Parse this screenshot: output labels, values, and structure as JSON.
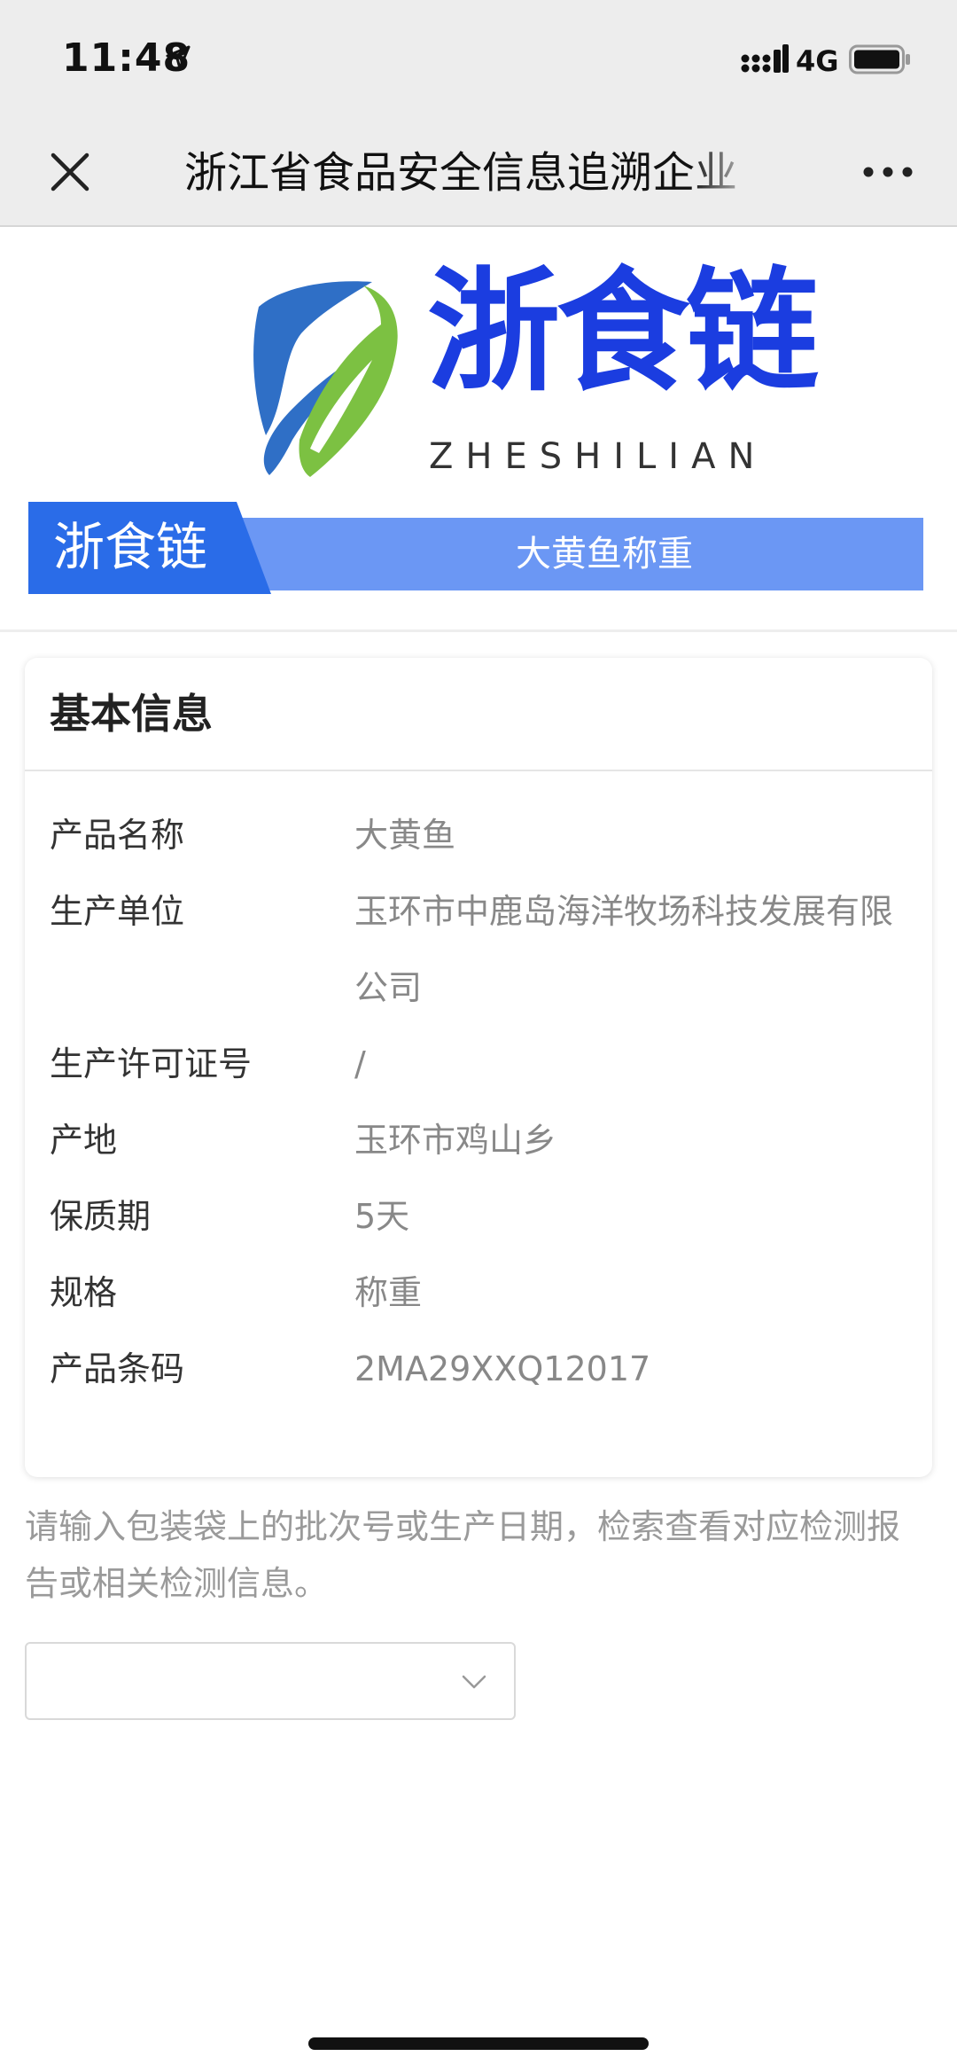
{
  "status_bar": {
    "time": "11:48",
    "network": "4G",
    "icons": [
      "location-arrow-icon",
      "signal-icon",
      "battery-icon"
    ]
  },
  "nav": {
    "title": "浙江省食品安全信息追溯企业",
    "icons": [
      "close-icon",
      "more-icon"
    ]
  },
  "logo": {
    "cn": "浙食链",
    "en": "ZHESHILIAN"
  },
  "ribbon": {
    "tab_label": "浙食链",
    "title": "大黄鱼称重"
  },
  "basic_info": {
    "title": "基本信息",
    "rows": [
      {
        "label": "产品名称",
        "value": "大黄鱼"
      },
      {
        "label": "生产单位",
        "value": "玉环市中鹿岛海洋牧场科技发展有限公司"
      },
      {
        "label": "生产许可证号",
        "value": "/"
      },
      {
        "label": "产地",
        "value": "玉环市鸡山乡"
      },
      {
        "label": "保质期",
        "value": "5天"
      },
      {
        "label": "规格",
        "value": "称重"
      },
      {
        "label": "产品条码",
        "value": "2MA29XXQ12017"
      }
    ]
  },
  "hint": "请输入包装袋上的批次号或生产日期，检索查看对应检测报告或相关检测信息。",
  "batch_select": {
    "value": ""
  },
  "colors": {
    "brand_blue": "#1b3de0",
    "ribbon_dark": "#2a6ce8",
    "ribbon_light": "#6b97f4",
    "logo_green": "#7cc142",
    "logo_blue": "#2f6fc6"
  }
}
